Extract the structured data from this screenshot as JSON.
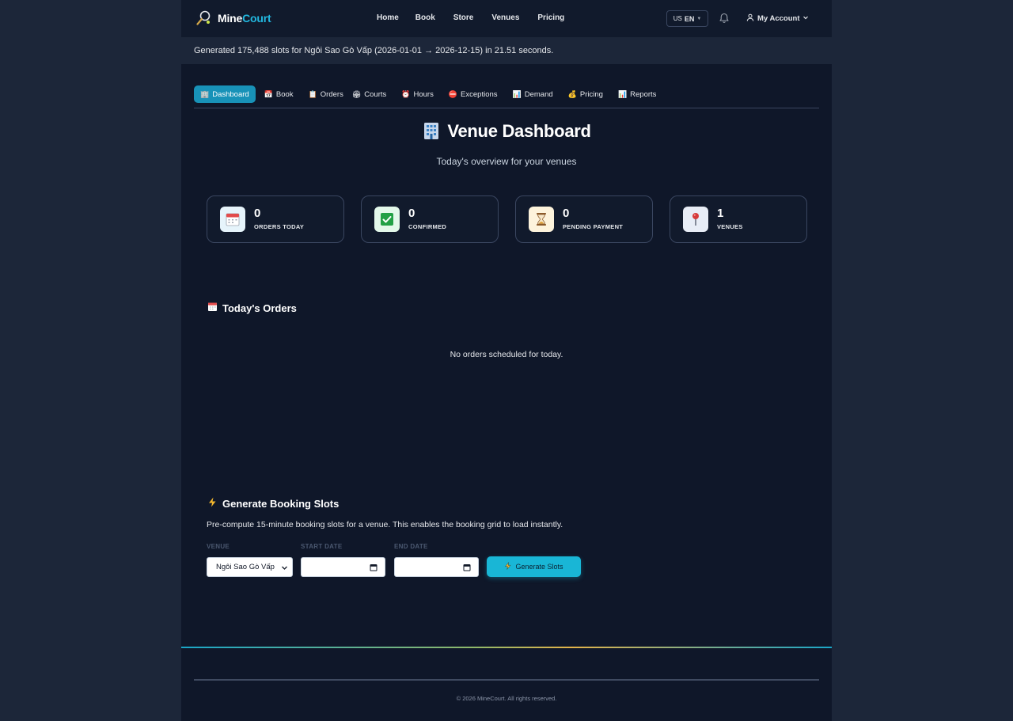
{
  "brand": {
    "name_part1": "Mine",
    "name_part2": "Court"
  },
  "nav": {
    "links": [
      "Home",
      "Book",
      "Store",
      "Venues",
      "Pricing"
    ]
  },
  "lang": {
    "flag": "US",
    "code": "EN"
  },
  "account": {
    "label": "My Account"
  },
  "banner": {
    "text": "Generated 175,488 slots for Ngôi Sao Gò Vấp (2026-01-01 → 2026-12-15) in 21.51 seconds."
  },
  "tabs": [
    {
      "icon": "🏢",
      "label": "Dashboard",
      "active": true
    },
    {
      "icon": "📅",
      "label": "Book"
    },
    {
      "icon": "📋",
      "label": "Orders"
    },
    {
      "icon": "🏟",
      "label": "Courts"
    },
    {
      "icon": "⏰",
      "label": "Hours"
    },
    {
      "icon": "⛔",
      "label": "Exceptions"
    },
    {
      "icon": "📊",
      "label": "Demand"
    },
    {
      "icon": "💰",
      "label": "Pricing"
    },
    {
      "icon": "📊",
      "label": "Reports"
    }
  ],
  "page": {
    "title": "Venue Dashboard",
    "subtitle": "Today's overview for your venues"
  },
  "stats": [
    {
      "value": "0",
      "label": "ORDERS TODAY",
      "icon": "calendar-icon",
      "bg": "#e6f4fb"
    },
    {
      "value": "0",
      "label": "CONFIRMED",
      "icon": "check-icon",
      "bg": "#e3f8ea"
    },
    {
      "value": "0",
      "label": "PENDING PAYMENT",
      "icon": "hourglass-icon",
      "bg": "#fdf3dc"
    },
    {
      "value": "1",
      "label": "VENUES",
      "icon": "location-pin-icon",
      "bg": "#e8edf6"
    }
  ],
  "orders": {
    "title": "Today's Orders",
    "empty": "No orders scheduled for today."
  },
  "generate": {
    "title": "Generate Booking Slots",
    "description": "Pre-compute 15-minute booking slots for a venue. This enables the booking grid to load instantly.",
    "venue_label": "VENUE",
    "venue_value": "Ngôi Sao Gò Vấp",
    "start_label": "START DATE",
    "end_label": "END DATE",
    "button": "Generate Slots"
  },
  "footer": {
    "text": "© 2026 MineCourt. All rights reserved."
  }
}
